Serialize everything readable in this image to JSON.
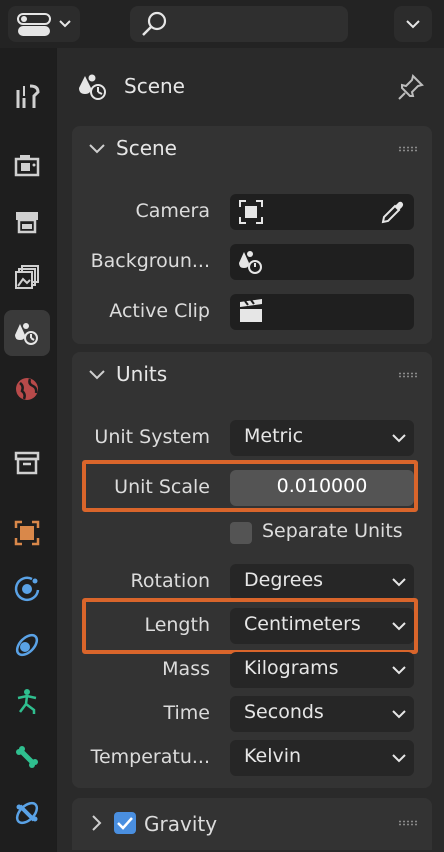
{
  "topbar": {
    "search_placeholder": ""
  },
  "sidebar": {
    "tabs": [
      {
        "name": "tool",
        "icon": "tool-icon"
      },
      {
        "name": "render",
        "icon": "render-icon"
      },
      {
        "name": "output",
        "icon": "output-icon"
      },
      {
        "name": "view-layer",
        "icon": "view-layer-icon"
      },
      {
        "name": "scene",
        "icon": "scene-icon",
        "active": true
      },
      {
        "name": "world",
        "icon": "world-icon"
      },
      {
        "name": "collection",
        "icon": "collection-icon"
      },
      {
        "name": "object",
        "icon": "object-icon"
      },
      {
        "name": "modifiers",
        "icon": "modifier-icon"
      },
      {
        "name": "particles",
        "icon": "particles-icon"
      },
      {
        "name": "physics",
        "icon": "physics-icon"
      },
      {
        "name": "object-data",
        "icon": "armature-icon"
      },
      {
        "name": "bone",
        "icon": "bone-constraint-icon"
      }
    ]
  },
  "header": {
    "title": "Scene"
  },
  "scene_panel": {
    "title": "Scene",
    "camera_label": "Camera",
    "background_label": "Backgroun...",
    "active_clip_label": "Active Clip"
  },
  "units_panel": {
    "title": "Units",
    "unit_system_label": "Unit System",
    "unit_system_value": "Metric",
    "unit_scale_label": "Unit Scale",
    "unit_scale_value": "0.010000",
    "separate_units_label": "Separate Units",
    "separate_units_checked": false,
    "rotation_label": "Rotation",
    "rotation_value": "Degrees",
    "length_label": "Length",
    "length_value": "Centimeters",
    "mass_label": "Mass",
    "mass_value": "Kilograms",
    "time_label": "Time",
    "time_value": "Seconds",
    "temperature_label": "Temperatu...",
    "temperature_value": "Kelvin"
  },
  "gravity_panel": {
    "title": "Gravity",
    "checked": true
  },
  "colors": {
    "highlight": "#d9652b",
    "checkbox_checked": "#4a8fe0",
    "active_tab": "#3a3a3a"
  }
}
